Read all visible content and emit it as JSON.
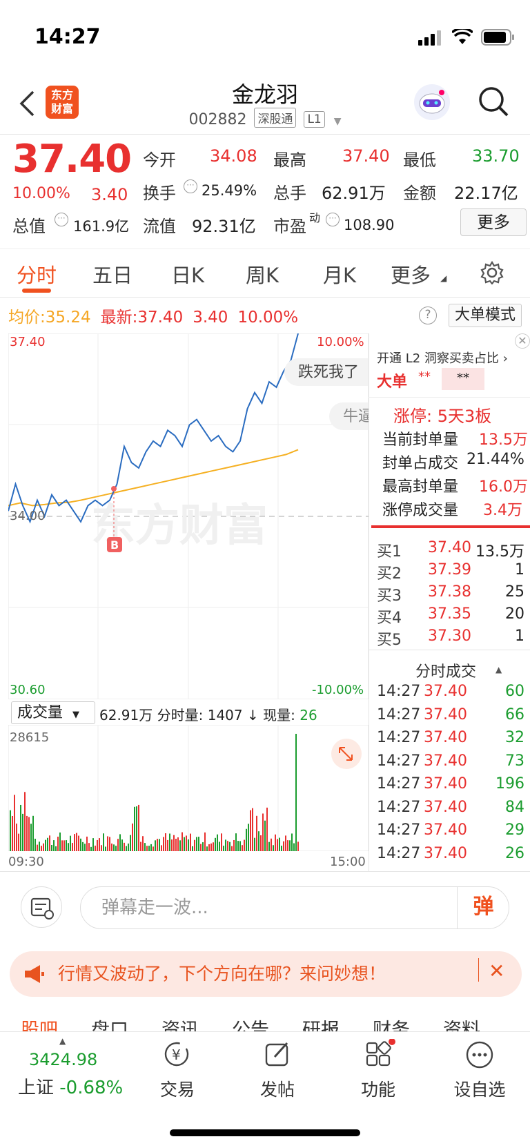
{
  "status": {
    "time": "14:27"
  },
  "header": {
    "name": "金龙羽",
    "code": "002882",
    "tag1": "深股通",
    "tag2": "L1",
    "logo_line1": "东方",
    "logo_line2": "财富"
  },
  "quote": {
    "price": "37.40",
    "pct": "10.00%",
    "chg": "3.40",
    "open_label": "今开",
    "open": "34.08",
    "high_label": "最高",
    "high": "37.40",
    "low_label": "最低",
    "low": "33.70",
    "turnover_label": "换手",
    "turnover": "25.49%",
    "vol_label": "总手",
    "vol": "62.91万",
    "amount_label": "金额",
    "amount": "22.17亿",
    "mktcap_label": "总值",
    "mktcap": "161.9亿",
    "float_label": "流值",
    "float": "92.31亿",
    "pe_label": "市盈",
    "pe_sup": "动",
    "pe": "108.90",
    "more": "更多"
  },
  "tabs": [
    "分时",
    "五日",
    "日K",
    "周K",
    "月K",
    "更多"
  ],
  "infoline": {
    "avg_label": "均价:",
    "avg": "35.24",
    "last_label": "最新:",
    "last": "37.40",
    "chg": "3.40",
    "pct": "10.00%",
    "big_mode": "大单模式",
    "help": "?"
  },
  "chart": {
    "top_price": "37.40",
    "top_pct": "10.00%",
    "mid_price": "34.00",
    "bottom_price": "30.60",
    "bottom_pct": "-10.00%",
    "marker": "B",
    "watermark": "东方财富",
    "danmu1": "跌死我了",
    "danmu2": "牛逼"
  },
  "chart_data": {
    "type": "line",
    "x_start": "09:30",
    "x_end": "15:00",
    "ylim": [
      30.6,
      37.4
    ],
    "series": [
      {
        "values": [
          34.1,
          34.6,
          34.2,
          33.9,
          34.3,
          34.0,
          34.4,
          34.2,
          34.3,
          34.1,
          33.9,
          34.2,
          34.3,
          34.2,
          34.3,
          34.6,
          35.3,
          35.0,
          34.9,
          35.2,
          35.4,
          35.3,
          35.6,
          35.5,
          35.3,
          35.7,
          35.8,
          35.6,
          35.4,
          35.5,
          35.3,
          35.2,
          35.4,
          36.0,
          36.3,
          36.1,
          36.5,
          36.4,
          36.7,
          36.9,
          37.4
        ]
      },
      {
        "values": [
          34.2,
          34.25,
          34.2,
          34.22,
          34.25,
          34.26,
          34.3,
          34.35,
          34.4,
          34.45,
          34.5,
          34.55,
          34.6,
          34.65,
          34.7,
          34.75,
          34.8,
          34.85,
          34.9,
          34.95,
          35.0,
          35.05,
          35.1,
          35.15,
          35.24
        ]
      }
    ]
  },
  "volume": {
    "selector": "成交量",
    "total": "62.91万",
    "minute_label": "分时量:",
    "minute": "1407 ↓",
    "now_label": "现量:",
    "now": "26",
    "max": "28615",
    "t_start": "09:30",
    "t_end": "15:00"
  },
  "panel": {
    "l2_label": "开通 L2 洞察买卖占比",
    "big_label": "大单",
    "big_red": "**",
    "big_grey": "**",
    "limit_title": "涨停: 5天3板",
    "rows": [
      {
        "k": "当前封单量",
        "v": "13.5万"
      },
      {
        "k": "封单占成交",
        "v": "21.44%"
      },
      {
        "k": "最高封单量",
        "v": "16.0万"
      },
      {
        "k": "涨停成交量",
        "v": "3.4万"
      }
    ],
    "bids": [
      {
        "k": "买1",
        "p": "37.40",
        "q": "13.5万"
      },
      {
        "k": "买2",
        "p": "37.39",
        "q": "1"
      },
      {
        "k": "买3",
        "p": "37.38",
        "q": "25"
      },
      {
        "k": "买4",
        "p": "37.35",
        "q": "20"
      },
      {
        "k": "买5",
        "p": "37.30",
        "q": "1"
      }
    ],
    "trades_title": "分时成交",
    "trades": [
      {
        "t": "14:27",
        "p": "37.40",
        "q": "60"
      },
      {
        "t": "14:27",
        "p": "37.40",
        "q": "66"
      },
      {
        "t": "14:27",
        "p": "37.40",
        "q": "32"
      },
      {
        "t": "14:27",
        "p": "37.40",
        "q": "73"
      },
      {
        "t": "14:27",
        "p": "37.40",
        "q": "196"
      },
      {
        "t": "14:27",
        "p": "37.40",
        "q": "84"
      },
      {
        "t": "14:27",
        "p": "37.40",
        "q": "29"
      },
      {
        "t": "14:27",
        "p": "37.40",
        "q": "26"
      }
    ]
  },
  "danmu": {
    "placeholder": "弹幕走一波...",
    "button": "弹"
  },
  "banner": {
    "text": "行情又波动了，下个方向在哪？来问妙想！"
  },
  "subtabs": [
    "股吧",
    "盘口",
    "资讯",
    "公告",
    "研报",
    "财务",
    "资料"
  ],
  "bottom_nav": {
    "index_value": "3424.98",
    "index_name": "上证",
    "index_pct": "-0.68%",
    "trade": "交易",
    "post": "发帖",
    "func": "功能",
    "watch": "设自选"
  }
}
